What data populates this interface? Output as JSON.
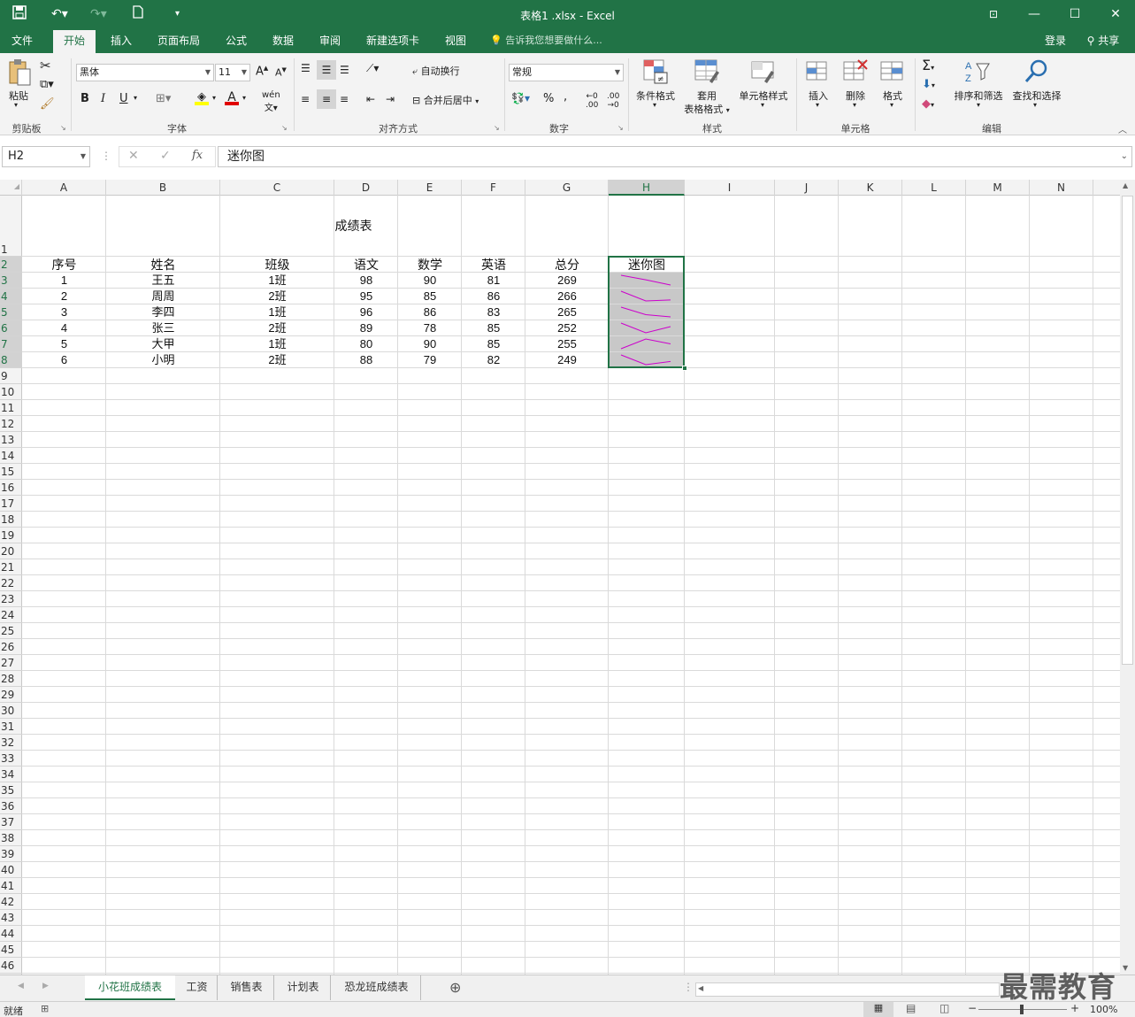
{
  "window": {
    "title": "表格1 .xlsx - Excel"
  },
  "ribbon": {
    "tabs": [
      "文件",
      "开始",
      "插入",
      "页面布局",
      "公式",
      "数据",
      "审阅",
      "新建选项卡",
      "视图"
    ],
    "tell_me": "告诉我您想要做什么...",
    "login": "登录",
    "share": "共享",
    "groups": {
      "clipboard": "剪贴板",
      "font": "字体",
      "align": "对齐方式",
      "number": "数字",
      "styles": "样式",
      "cells": "单元格",
      "editing": "编辑"
    },
    "paste": "粘贴",
    "font_name": "黑体",
    "font_size": "11",
    "wrap": "自动换行",
    "merge": "合并后居中",
    "number_format": "常规",
    "cond_format": "条件格式",
    "table_fmt_1": "套用",
    "table_fmt_2": "表格格式",
    "cell_styles": "单元格样式",
    "insert": "插入",
    "delete": "删除",
    "format": "格式",
    "sort": "排序和筛选",
    "find": "查找和选择"
  },
  "formula_bar": {
    "name_box": "H2",
    "formula": "迷你图"
  },
  "sheet": {
    "columns": [
      "A",
      "B",
      "C",
      "D",
      "E",
      "F",
      "G",
      "H",
      "I",
      "J",
      "K",
      "L",
      "M",
      "N"
    ],
    "title": "成绩表",
    "headers": [
      "序号",
      "姓名",
      "班级",
      "语文",
      "数学",
      "英语",
      "总分",
      "迷你图"
    ],
    "rows": [
      [
        "1",
        "王五",
        "1班",
        "98",
        "90",
        "81",
        "269"
      ],
      [
        "2",
        "周周",
        "2班",
        "95",
        "85",
        "86",
        "266"
      ],
      [
        "3",
        "李四",
        "1班",
        "96",
        "86",
        "83",
        "265"
      ],
      [
        "4",
        "张三",
        "2班",
        "89",
        "78",
        "85",
        "252"
      ],
      [
        "5",
        "大甲",
        "1班",
        "80",
        "90",
        "85",
        "255"
      ],
      [
        "6",
        "小明",
        "2班",
        "88",
        "79",
        "82",
        "249"
      ]
    ],
    "sparkline_color": "#cc00cc",
    "selection_fill": "#c8c8c8"
  },
  "sheet_tabs": [
    "小花班成绩表",
    "工资",
    "销售表",
    "计划表",
    "恐龙班成绩表"
  ],
  "status": {
    "ready": "就绪",
    "zoom": "100%"
  },
  "watermark": "最需教育"
}
